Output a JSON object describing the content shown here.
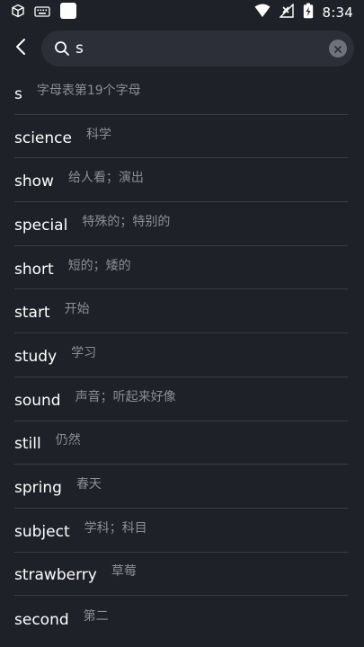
{
  "status_bar": {
    "time": "8:34",
    "icons": [
      "cube-icon",
      "keyboard-icon",
      "square-app-icon",
      "wifi-icon",
      "no-signal-icon",
      "battery-charging-icon"
    ]
  },
  "search": {
    "value": "s",
    "placeholder": "",
    "icons": [
      "back-arrow-icon",
      "search-icon",
      "clear-icon"
    ]
  },
  "words": [
    {
      "en": "s",
      "zh": "字母表第19个字母"
    },
    {
      "en": "science",
      "zh": "科学"
    },
    {
      "en": "show",
      "zh": "给人看；演出"
    },
    {
      "en": "special",
      "zh": "特殊的；特别的"
    },
    {
      "en": "short",
      "zh": "短的；矮的"
    },
    {
      "en": "start",
      "zh": "开始"
    },
    {
      "en": "study",
      "zh": "学习"
    },
    {
      "en": "sound",
      "zh": "声音；听起来好像"
    },
    {
      "en": "still",
      "zh": "仍然"
    },
    {
      "en": "spring",
      "zh": "春天"
    },
    {
      "en": "subject",
      "zh": "学科；科目"
    },
    {
      "en": "strawberry",
      "zh": "草莓"
    },
    {
      "en": "second",
      "zh": "第二"
    }
  ],
  "colors": {
    "background": "#1f2128",
    "search_box": "#2c2f37",
    "divider": "#3a3d45",
    "primary_text": "#ffffff",
    "secondary_text": "#8b8e96"
  }
}
